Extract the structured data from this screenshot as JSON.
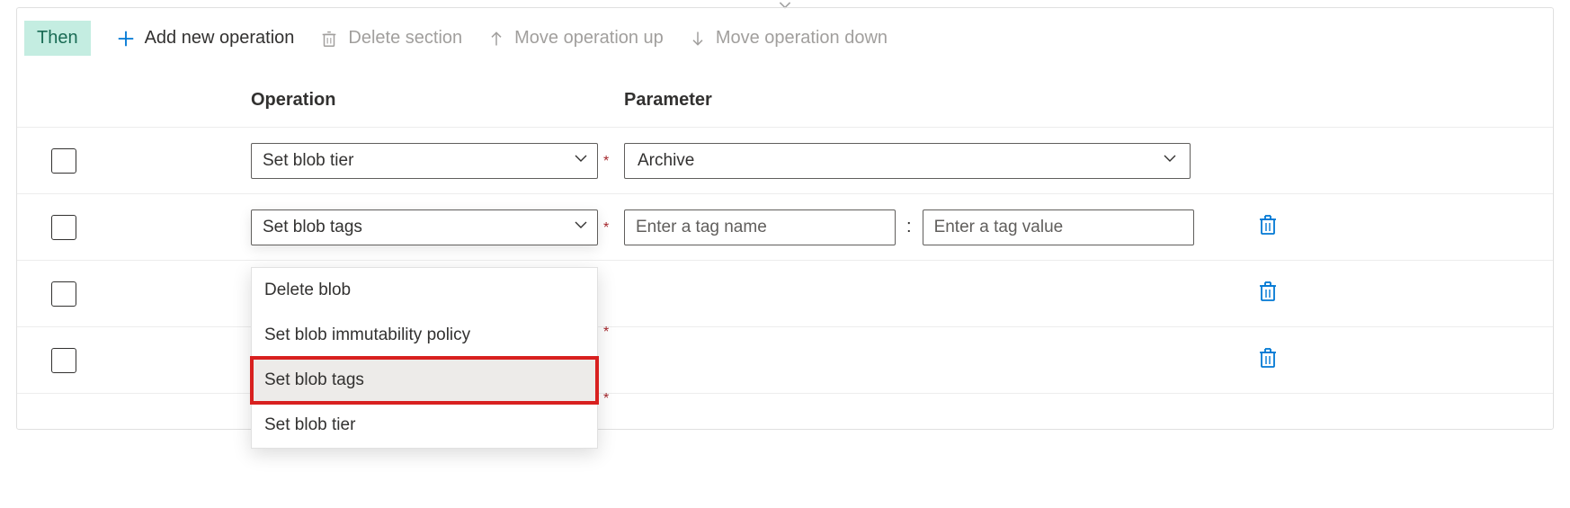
{
  "badge": "Then",
  "toolbar": {
    "add": "Add new operation",
    "delete": "Delete section",
    "moveUp": "Move operation up",
    "moveDown": "Move operation down"
  },
  "headers": {
    "operation": "Operation",
    "parameter": "Parameter"
  },
  "rows": [
    {
      "operation": "Set blob tier",
      "parameter_select": "Archive"
    },
    {
      "operation": "Set blob tags",
      "tag_name_placeholder": "Enter a tag name",
      "tag_value_placeholder": "Enter a tag value"
    },
    {
      "operation": ""
    },
    {
      "operation": ""
    }
  ],
  "required_marker": "*",
  "tag_separator": ":",
  "dropdown": {
    "options": [
      "Delete blob",
      "Set blob immutability policy",
      "Set blob tags",
      "Set blob tier"
    ],
    "selected_index": 2
  }
}
